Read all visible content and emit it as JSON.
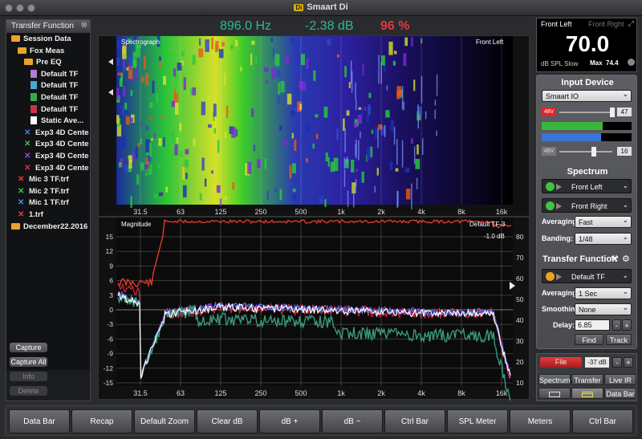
{
  "window": {
    "title": "Smaart Di",
    "logo": "Di"
  },
  "left_panel": {
    "header": "Transfer Function",
    "close": "⊗",
    "tree": [
      {
        "label": "Session Data",
        "icon": "folder",
        "depth": 0
      },
      {
        "label": "Fox Meas",
        "icon": "folder",
        "depth": 1
      },
      {
        "label": "Pre EQ",
        "icon": "folder",
        "depth": 2
      },
      {
        "label": "Default TF",
        "icon": "doc",
        "color": "#b07bd6",
        "depth": 3
      },
      {
        "label": "Default TF",
        "icon": "doc",
        "color": "#4ea3d9",
        "depth": 3
      },
      {
        "label": "Default TF",
        "icon": "doc",
        "color": "#3aa84a",
        "depth": 3
      },
      {
        "label": "Default TF",
        "icon": "doc",
        "color": "#c8324a",
        "depth": 3
      },
      {
        "label": "Static Ave...",
        "icon": "doc",
        "color": "#ffffff",
        "depth": 3
      },
      {
        "label": "Exp3 4D Cente",
        "icon": "x",
        "color": "#3d7de0",
        "depth": 2
      },
      {
        "label": "Exp3 4D Cente",
        "icon": "x",
        "color": "#43b84a",
        "depth": 2
      },
      {
        "label": "Exp3 4D Cente",
        "icon": "x",
        "color": "#9a4dd8",
        "depth": 2
      },
      {
        "label": "Exp3 4D Cente",
        "icon": "x",
        "color": "#d2334a",
        "depth": 2
      },
      {
        "label": "Mic 3 TF.trf",
        "icon": "x",
        "color": "#e53a3a",
        "depth": 1
      },
      {
        "label": "Mic 2 TF.trf",
        "icon": "x",
        "color": "#39c24a",
        "depth": 1
      },
      {
        "label": "Mic 1 TF.trf",
        "icon": "x",
        "color": "#4c8be6",
        "depth": 1
      },
      {
        "label": "1.trf",
        "icon": "x",
        "color": "#e53a3a",
        "depth": 1
      },
      {
        "label": "December22.2016",
        "icon": "folder",
        "depth": 0
      }
    ],
    "buttons": [
      "Capture",
      "Capture All",
      "Info",
      "Delete"
    ]
  },
  "readout": {
    "freq": "896.0 Hz",
    "level": "-2.38 dB",
    "coherence": "96 %"
  },
  "spectrograph": {
    "title": "Spectrograph",
    "channel": "Front Left",
    "freq_ticks": [
      "31.5",
      "63",
      "125",
      "250",
      "500",
      "1k",
      "2k",
      "4k",
      "8k",
      "16k"
    ]
  },
  "magnitude": {
    "title": "Magnitude",
    "trace": "Default TF-3",
    "offset": "-1.0 dB",
    "y_ticks": [
      "15",
      "12",
      "9",
      "6",
      "3",
      "0",
      "-3",
      "-6",
      "-9",
      "-12",
      "-15"
    ],
    "coherence_ticks": [
      "80",
      "70",
      "60",
      "50",
      "40",
      "30",
      "20",
      "10"
    ],
    "freq_ticks": [
      "31.5",
      "63",
      "125",
      "250",
      "500",
      "1k",
      "2k",
      "4k",
      "8k",
      "16k"
    ]
  },
  "meter": {
    "left_label": "Front Left",
    "right_label": "Front Right",
    "value": "70.0",
    "mode": "dB SPL Slow",
    "max_label": "Max",
    "max_value": "74.4"
  },
  "input_device": {
    "title": "Input Device",
    "device": "Smaart IO",
    "gain1_badge": "48V",
    "gain1_value": "47",
    "gain2_badge": "48V",
    "gain2_value": "16"
  },
  "spectrum": {
    "title": "Spectrum",
    "channels": [
      {
        "label": "Front Left",
        "color": "#3ec43e"
      },
      {
        "label": "Front Right",
        "color": "#3ec43e"
      }
    ],
    "averaging_label": "Averaging:",
    "averaging": "Fast",
    "banding_label": "Banding:",
    "banding": "1/48"
  },
  "transfer": {
    "title": "Transfer Function",
    "channel": {
      "label": "Default TF",
      "color": "#f0a020"
    },
    "averaging_label": "Averaging:",
    "averaging": "1 Sec",
    "smoothing_label": "Smoothing:",
    "smoothing": "None",
    "delay_label": "Delay:",
    "delay": "6.85",
    "find": "Find",
    "track": "Track"
  },
  "generator": {
    "file": "File",
    "level": "-37 dB",
    "minus": "-",
    "plus": "+"
  },
  "views": {
    "spectrum": "Spectrum",
    "transfer": "Transfer",
    "live_ir": "Live IR",
    "data_bar": "Data Bar"
  },
  "toolbar": [
    "Data Bar",
    "Recap",
    "Default Zoom",
    "Clear dB",
    "dB +",
    "dB −",
    "Ctrl Bar",
    "SPL Meter",
    "Meters",
    "Ctrl Bar"
  ]
}
